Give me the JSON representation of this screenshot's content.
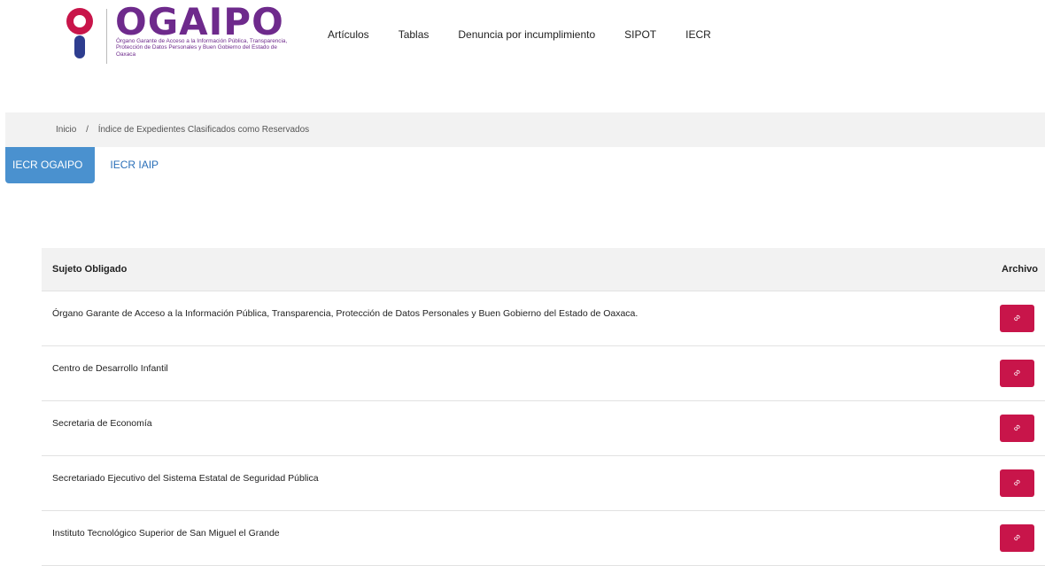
{
  "header": {
    "logo_word": "OGAIPO",
    "logo_subtitle": "Órgano Garante de Acceso a la Información Pública, Transparencia, Protección de Datos Personales y Buen Gobierno del Estado de Oaxaca",
    "nav": [
      "Artículos",
      "Tablas",
      "Denuncia por incumplimiento",
      "SIPOT",
      "IECR"
    ]
  },
  "breadcrumb": {
    "home": "Inicio",
    "separator": "/",
    "current": "Índice de Expedientes Clasificados como Reservados"
  },
  "tabs": [
    {
      "label": "IECR OGAIPO",
      "active": true
    },
    {
      "label": "IECR IAIP",
      "active": false
    }
  ],
  "table": {
    "headers": {
      "subject": "Sujeto Obligado",
      "file": "Archivo"
    },
    "rows": [
      "Órgano Garante de Acceso a la Información Pública, Transparencia, Protección de Datos Personales y Buen Gobierno del Estado de Oaxaca.",
      "Centro de Desarrollo Infantil",
      "Secretaria de Economía",
      "Secretariado Ejecutivo del Sistema Estatal de Seguridad Pública",
      "Instituto Tecnológico Superior de San Miguel el Grande"
    ]
  },
  "colors": {
    "brand_purple": "#6e2a8c",
    "brand_magenta": "#c8154a",
    "tab_active": "#4a91cf",
    "link_blue": "#2a6fb8"
  },
  "icons": {
    "file_button": "link-icon",
    "logo": "info-person-icon"
  }
}
